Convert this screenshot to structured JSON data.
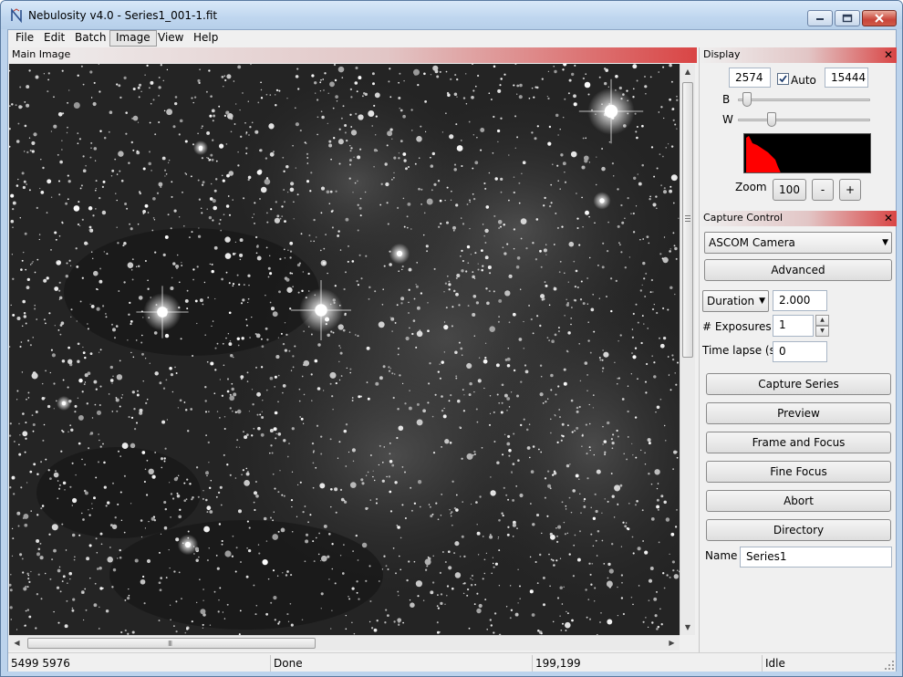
{
  "window": {
    "title": "Nebulosity v4.0 - Series1_001-1.fit"
  },
  "menu": [
    "File",
    "Edit",
    "Batch",
    "Image",
    "View",
    "Help"
  ],
  "main_image": {
    "header": "Main Image"
  },
  "display": {
    "header": "Display",
    "close_glyph": "✕",
    "black_value": "2574",
    "white_value": "15444",
    "auto_label": "Auto",
    "auto_checked": true,
    "b_label": "B",
    "w_label": "W",
    "zoom_label": "Zoom",
    "zoom_value": "100",
    "zoom_minus": "-",
    "zoom_plus": "+"
  },
  "capture": {
    "header": "Capture Control",
    "close_glyph": "✕",
    "camera": "ASCOM Camera",
    "advanced": "Advanced",
    "duration_label": "Duration",
    "duration_value": "2.000",
    "exposures_label": "# Exposures",
    "exposures_value": "1",
    "timelapse_label": "Time lapse (s)",
    "timelapse_value": "0",
    "buttons": [
      "Capture Series",
      "Preview",
      "Frame and Focus",
      "Fine Focus",
      "Abort",
      "Directory"
    ],
    "name_label": "Name",
    "name_value": "Series1"
  },
  "status": [
    "5499 5976",
    "Done",
    "199,199",
    "Idle"
  ],
  "colors": {
    "header_red": "#d94545",
    "histogram_fill": "#ff0000"
  }
}
